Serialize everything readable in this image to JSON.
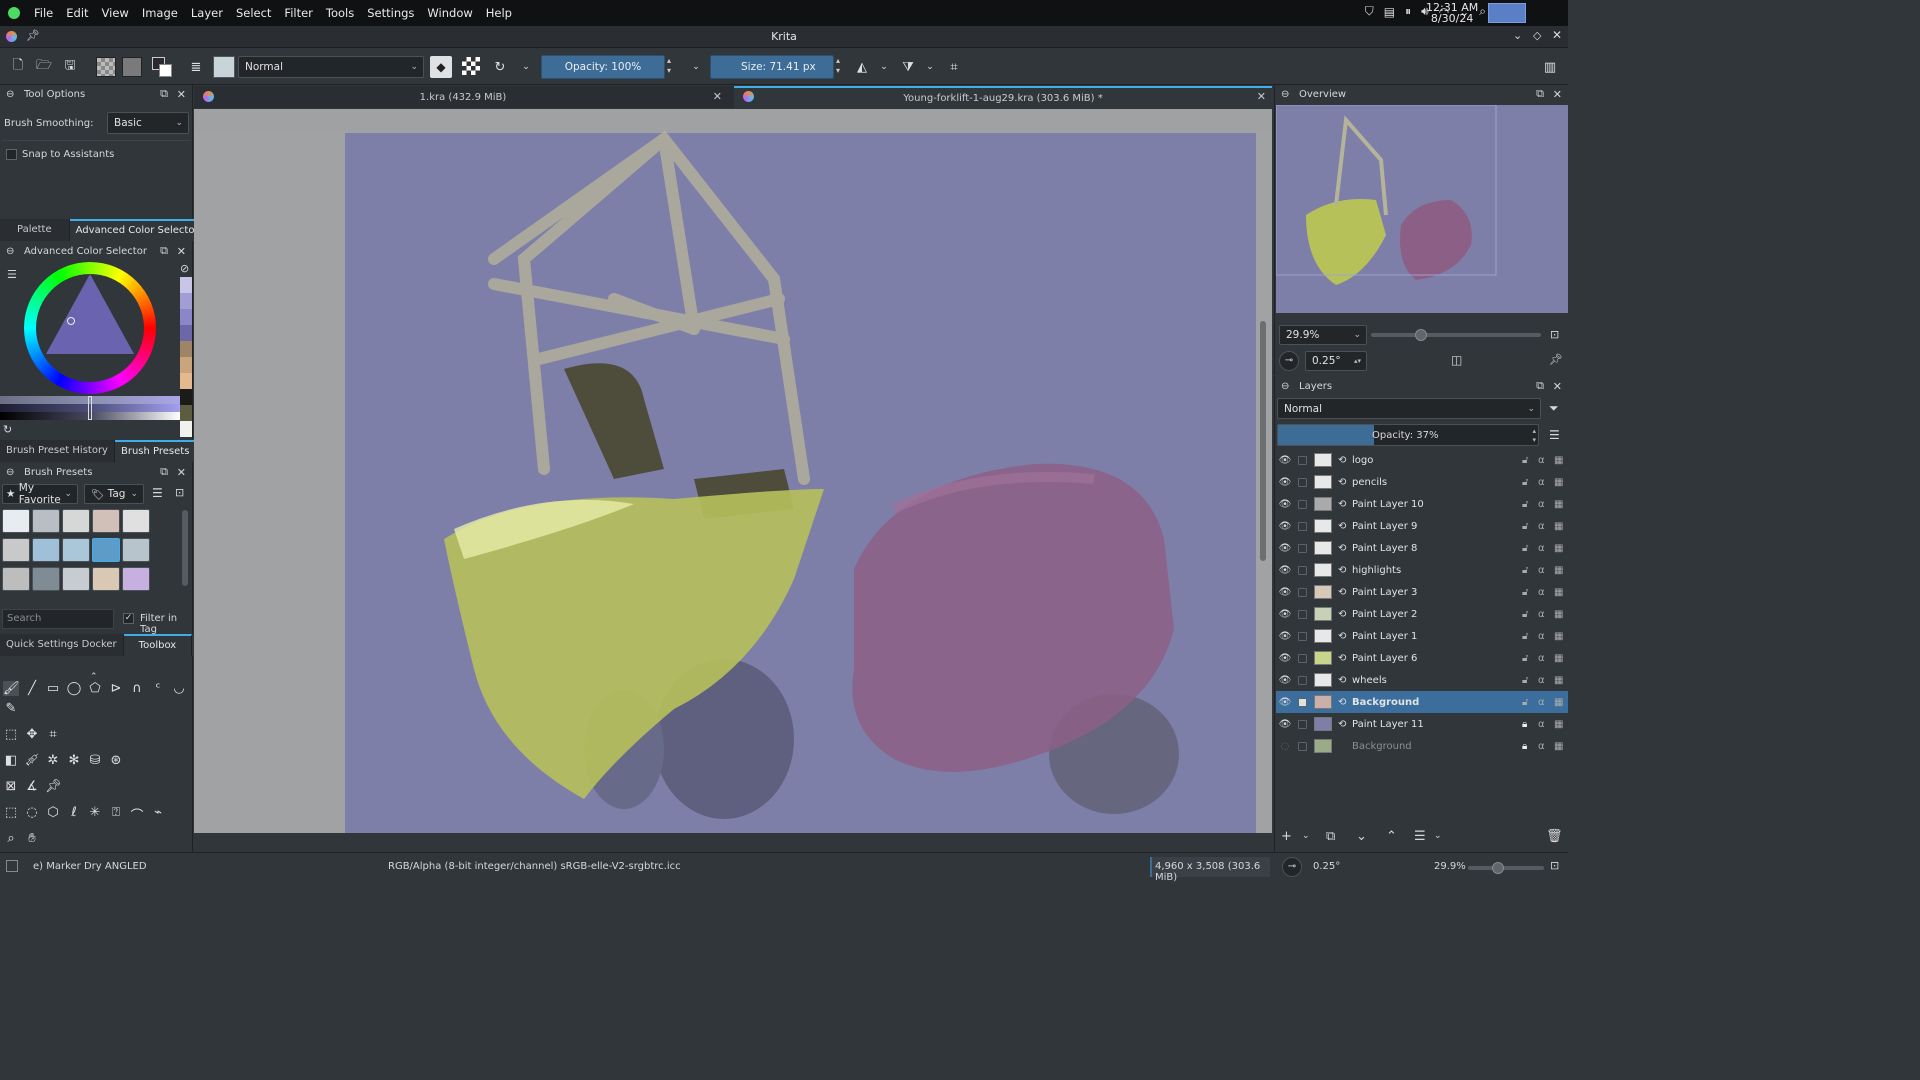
{
  "menubar": {
    "items": [
      "File",
      "Edit",
      "View",
      "Image",
      "Layer",
      "Select",
      "Filter",
      "Tools",
      "Settings",
      "Window",
      "Help"
    ],
    "clock_time": "12:31 AM",
    "clock_date": "8/30/24"
  },
  "window": {
    "title": "Krita"
  },
  "toolbar": {
    "blend_mode": "Normal",
    "opacity": "Opacity: 100%",
    "opacity_fraction": 1.0,
    "size_label": "Size:",
    "size_value": "71.41 px"
  },
  "tool_options": {
    "title": "Tool Options",
    "smoothing_label": "Brush Smoothing:",
    "smoothing_value": "Basic",
    "snap_label": "Snap to Assistants"
  },
  "color_tabs": [
    "Palette",
    "Advanced Color Selector"
  ],
  "color_selector": {
    "title": "Advanced Color Selector"
  },
  "preset_tabs": [
    "Brush Preset History",
    "Brush Presets"
  ],
  "presets": {
    "title": "Brush Presets",
    "tag_filter": "My Favorite",
    "tag_label": "Tag",
    "search_placeholder": "Search",
    "filter_label": "Filter in Tag"
  },
  "lower_tabs": [
    "Quick Settings Docker",
    "Toolbox"
  ],
  "documents": [
    {
      "title": "1.kra (432.9 MiB)"
    },
    {
      "title": "Young-forklift-1-aug29.kra (303.6 MiB) *"
    }
  ],
  "overview": {
    "title": "Overview",
    "zoom": "29.9%",
    "rotation": "0.25°"
  },
  "layers": {
    "title": "Layers",
    "blend": "Normal",
    "opacity": "Opacity:  37%",
    "opacity_fraction": 0.37,
    "items": [
      {
        "name": "logo"
      },
      {
        "name": "pencils"
      },
      {
        "name": "Paint Layer 10"
      },
      {
        "name": "Paint Layer 9"
      },
      {
        "name": "Paint Layer 8"
      },
      {
        "name": "highlights"
      },
      {
        "name": "Paint Layer 3"
      },
      {
        "name": "Paint Layer 2"
      },
      {
        "name": "Paint Layer 1"
      },
      {
        "name": "Paint Layer 6"
      },
      {
        "name": "wheels"
      },
      {
        "name": "Background"
      },
      {
        "name": "Paint Layer 11"
      },
      {
        "name": "Background"
      }
    ]
  },
  "status": {
    "brush": "e) Marker Dry ANGLED",
    "color_space": "RGB/Alpha (8-bit integer/channel)  sRGB-elle-V2-srgbtrc.icc",
    "dims": "4,960 x 3,508 (303.6 MiB)",
    "rotation": "0.25°",
    "zoom": "29.9%"
  },
  "colors": {
    "accent": "#3daee9",
    "selection": "#3b6e9c",
    "canvas_bg": "#7e7fa8"
  }
}
